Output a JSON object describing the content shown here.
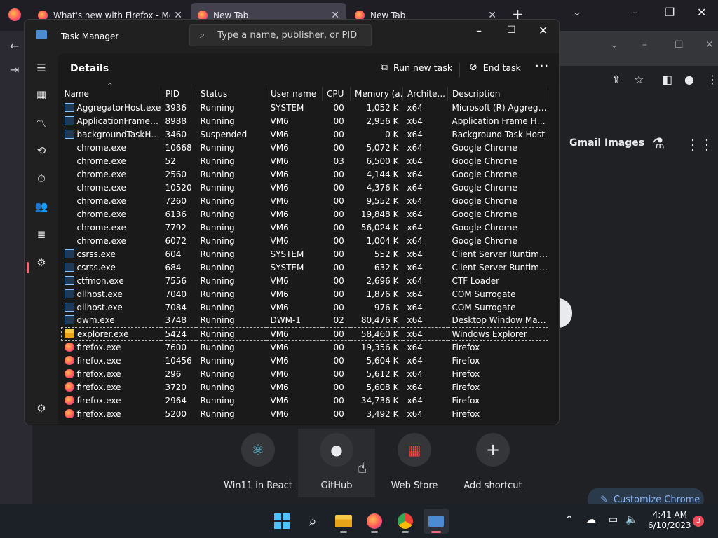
{
  "firefox": {
    "tabs": [
      {
        "title": "What's new with Firefox - More"
      },
      {
        "title": "New Tab"
      },
      {
        "title": "New Tab"
      }
    ],
    "new_tab": "+",
    "list_all": "⌄",
    "minimize": "–",
    "maximize": "❐",
    "close": "✕"
  },
  "chrome": {
    "links": [
      "Gmail",
      "Images"
    ],
    "shortcuts": [
      {
        "label": "Win11 in React",
        "icon": "⚛"
      },
      {
        "label": "GitHub",
        "icon": "●"
      },
      {
        "label": "Web Store",
        "icon": "▦"
      },
      {
        "label": "Add shortcut",
        "icon": "+"
      }
    ],
    "customize": "Customize Chrome"
  },
  "taskmanager": {
    "title": "Task Manager",
    "search_placeholder": "Type a name, publisher, or PID...",
    "page_title": "Details",
    "run_new_task": "Run new task",
    "end_task": "End task",
    "more": "···",
    "columns": [
      "Name",
      "PID",
      "Status",
      "User name",
      "CPU",
      "Memory (a...",
      "Archite...",
      "Description"
    ],
    "rows": [
      {
        "icon": "app",
        "name": "AggregatorHost.exe",
        "pid": "3936",
        "status": "Running",
        "user": "SYSTEM",
        "cpu": "00",
        "mem": "1,052 K",
        "arch": "x64",
        "desc": "Microsoft (R) Aggrega..."
      },
      {
        "icon": "app",
        "name": "ApplicationFrameHo...",
        "pid": "8988",
        "status": "Running",
        "user": "VM6",
        "cpu": "00",
        "mem": "2,956 K",
        "arch": "x64",
        "desc": "Application Frame Host"
      },
      {
        "icon": "app",
        "name": "backgroundTaskHos...",
        "pid": "3460",
        "status": "Suspended",
        "user": "VM6",
        "cpu": "00",
        "mem": "0 K",
        "arch": "x64",
        "desc": "Background Task Host"
      },
      {
        "icon": "chrome",
        "name": "chrome.exe",
        "pid": "10668",
        "status": "Running",
        "user": "VM6",
        "cpu": "00",
        "mem": "5,072 K",
        "arch": "x64",
        "desc": "Google Chrome"
      },
      {
        "icon": "chrome",
        "name": "chrome.exe",
        "pid": "52",
        "status": "Running",
        "user": "VM6",
        "cpu": "03",
        "mem": "6,500 K",
        "arch": "x64",
        "desc": "Google Chrome"
      },
      {
        "icon": "chrome",
        "name": "chrome.exe",
        "pid": "2560",
        "status": "Running",
        "user": "VM6",
        "cpu": "00",
        "mem": "4,144 K",
        "arch": "x64",
        "desc": "Google Chrome"
      },
      {
        "icon": "chrome",
        "name": "chrome.exe",
        "pid": "10520",
        "status": "Running",
        "user": "VM6",
        "cpu": "00",
        "mem": "4,376 K",
        "arch": "x64",
        "desc": "Google Chrome"
      },
      {
        "icon": "chrome",
        "name": "chrome.exe",
        "pid": "7260",
        "status": "Running",
        "user": "VM6",
        "cpu": "00",
        "mem": "9,552 K",
        "arch": "x64",
        "desc": "Google Chrome"
      },
      {
        "icon": "chrome",
        "name": "chrome.exe",
        "pid": "6136",
        "status": "Running",
        "user": "VM6",
        "cpu": "00",
        "mem": "19,848 K",
        "arch": "x64",
        "desc": "Google Chrome"
      },
      {
        "icon": "chrome",
        "name": "chrome.exe",
        "pid": "7792",
        "status": "Running",
        "user": "VM6",
        "cpu": "00",
        "mem": "56,024 K",
        "arch": "x64",
        "desc": "Google Chrome"
      },
      {
        "icon": "chrome",
        "name": "chrome.exe",
        "pid": "6072",
        "status": "Running",
        "user": "VM6",
        "cpu": "00",
        "mem": "1,004 K",
        "arch": "x64",
        "desc": "Google Chrome"
      },
      {
        "icon": "app",
        "name": "csrss.exe",
        "pid": "604",
        "status": "Running",
        "user": "SYSTEM",
        "cpu": "00",
        "mem": "552 K",
        "arch": "x64",
        "desc": "Client Server Runtime ..."
      },
      {
        "icon": "app",
        "name": "csrss.exe",
        "pid": "684",
        "status": "Running",
        "user": "SYSTEM",
        "cpu": "00",
        "mem": "632 K",
        "arch": "x64",
        "desc": "Client Server Runtime ..."
      },
      {
        "icon": "app",
        "name": "ctfmon.exe",
        "pid": "7556",
        "status": "Running",
        "user": "VM6",
        "cpu": "00",
        "mem": "2,696 K",
        "arch": "x64",
        "desc": "CTF Loader"
      },
      {
        "icon": "app",
        "name": "dllhost.exe",
        "pid": "7040",
        "status": "Running",
        "user": "VM6",
        "cpu": "00",
        "mem": "1,876 K",
        "arch": "x64",
        "desc": "COM Surrogate"
      },
      {
        "icon": "app",
        "name": "dllhost.exe",
        "pid": "7084",
        "status": "Running",
        "user": "VM6",
        "cpu": "00",
        "mem": "976 K",
        "arch": "x64",
        "desc": "COM Surrogate"
      },
      {
        "icon": "app",
        "name": "dwm.exe",
        "pid": "3748",
        "status": "Running",
        "user": "DWM-1",
        "cpu": "02",
        "mem": "80,476 K",
        "arch": "x64",
        "desc": "Desktop Window Man..."
      },
      {
        "icon": "folder",
        "name": "explorer.exe",
        "pid": "5424",
        "status": "Running",
        "user": "VM6",
        "cpu": "00",
        "mem": "58,460 K",
        "arch": "x64",
        "desc": "Windows Explorer",
        "selected": true
      },
      {
        "icon": "firefox",
        "name": "firefox.exe",
        "pid": "7600",
        "status": "Running",
        "user": "VM6",
        "cpu": "00",
        "mem": "19,356 K",
        "arch": "x64",
        "desc": "Firefox"
      },
      {
        "icon": "firefox",
        "name": "firefox.exe",
        "pid": "10456",
        "status": "Running",
        "user": "VM6",
        "cpu": "00",
        "mem": "5,604 K",
        "arch": "x64",
        "desc": "Firefox"
      },
      {
        "icon": "firefox",
        "name": "firefox.exe",
        "pid": "296",
        "status": "Running",
        "user": "VM6",
        "cpu": "00",
        "mem": "5,612 K",
        "arch": "x64",
        "desc": "Firefox"
      },
      {
        "icon": "firefox",
        "name": "firefox.exe",
        "pid": "3720",
        "status": "Running",
        "user": "VM6",
        "cpu": "00",
        "mem": "5,608 K",
        "arch": "x64",
        "desc": "Firefox"
      },
      {
        "icon": "firefox",
        "name": "firefox.exe",
        "pid": "2964",
        "status": "Running",
        "user": "VM6",
        "cpu": "00",
        "mem": "34,736 K",
        "arch": "x64",
        "desc": "Firefox"
      },
      {
        "icon": "firefox",
        "name": "firefox.exe",
        "pid": "5200",
        "status": "Running",
        "user": "VM6",
        "cpu": "00",
        "mem": "3,492 K",
        "arch": "x64",
        "desc": "Firefox"
      }
    ]
  },
  "taskbar": {
    "time": "4:41 AM",
    "date": "6/10/2023",
    "notification_count": "3"
  },
  "colors": {
    "accent": "#ea6b79",
    "link": "#8ab4f8"
  }
}
